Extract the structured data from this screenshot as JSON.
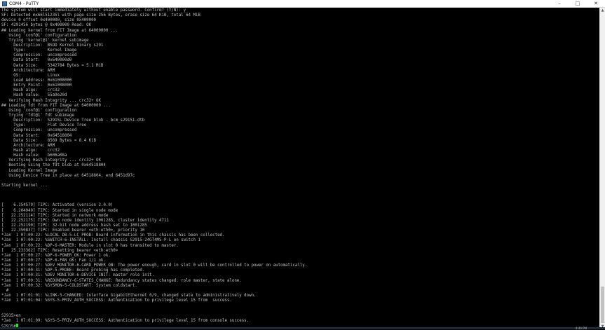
{
  "window": {
    "title": "COM4 - PuTTY",
    "controls": [
      "–",
      "□",
      "✕"
    ]
  },
  "terminal": {
    "lines": [
      "The system will start immediately without enable password. Confirm? (Y/N): y",
      "SF: Detected mx66l51235l with page size 256 Bytes, erase size 64 KiB, total 64 MiB",
      "device 0 offset 0x400000, size 0x400000",
      "SF: 4291456 bytes @ 0x400000 Read: OK",
      "## Loading kernel from FIT Image at 64000000 ...",
      "   Using 'conf@1' configuration",
      "   Trying 'kernel@1' kernel subimage",
      "     Description:  BSOD Kernel binary s291",
      "     Type:         Kernel Image",
      "     Compression:  uncompressed",
      "     Data Start:   0x640000d0",
      "     Data Size:    5342784 Bytes = 5.1 MiB",
      "     Architecture: ARM",
      "     OS:           Linux",
      "     Load Address: 0x61008000",
      "     Entry Point:  0x61008000",
      "     Hash algo:    crc32",
      "     Hash value:   55a9e20d",
      "   Verifying Hash Integrity ... crc32+ OK",
      "## Loading fdt from FIT Image at 64000000 ...",
      "   Using 'conf@1' configuration",
      "   Trying 'fdt@1' fdt subimage",
      "     Description:  S2915L Device Tree blob - bcm_s29151.dtb",
      "     Type:         Flat Device Tree",
      "     Compression:  uncompressed",
      "     Data Start:   0x64518804",
      "     Data Size:    8569 Bytes = 8.4 KiB",
      "     Architecture: ARM",
      "     Hash algo:    crc32",
      "     Hash value:   b606a08a",
      "   Verifying Hash Integrity ... crc32+ OK",
      "   Booting using the fdt blob at 0x64518804",
      "   Loading Kernel Image",
      "   Using Device Tree in place at 64518804, end 6451d97c",
      "",
      "Starting kernel ...",
      "",
      "",
      "",
      "[    6.154579] TIPC: Activated (version 2.0.0)",
      "[    6.204949] TIPC: Started in single node mode",
      "[   22.252114] TIPC: Started in network mode",
      "[   22.252175] TIPC: Own node identity 1001285, cluster identity 4711",
      "[   22.252190] TIPC: 32-bit node address hash set to 1001285",
      "[   22.350837] TIPC: Enabled bearer <eth:eth0>, priority 10",
      "*Jan  1 07:00:22: %LOCAL_DB-5-LC_PROB: Board information in this chassis has been collected.",
      "*Jan  1 07:00:22: %SWITCH-6-INSTALL: Install chassis S2915-24GT4MS-P-L on switch 1",
      "*Jan  1 07:00:22: %DP-6-MASTER: Module in slot 0 has transited to master.",
      "[   25.233362] TIPC: Resetting bearer <eth:eth0>",
      "*Jan  1 07:00:27: %DP-6-POWER_OK: Power 1 ok.",
      "*Jan  1 07:00:27: %DP-6-FAN_OK: Fan 1/1 ok.",
      "*Jan  1 07:00:27: %DEV_MONITOR-6-CARD_POWER_ON: The power enough, card in slot 0 will be controlled to power on automatically.",
      "*Jan  1 07:00:31: %DP-5-PROBE: Board probing has completed.",
      "*Jan  1 07:00:31: %DEV_MONITOR-6-DEVICE_INIT: master role init.",
      "*Jan  1 07:00:31: %REDUNDANCY-6-STATES_CHANGE: Redundancy states changed: role master, state alone.",
      "*Jan  1 07:00:32: %SYSMON-5-COLDSTART: System coldstart.",
      "  #",
      "*Jan  1 07:01:01: %LINK-5-CHANGED: Interface GigabitEthernet 0/9, changed state to administratively down.",
      "*Jan  1 07:01:04: %SYS-5-PRIV_AUTH_SUCCESS: Authentication to privilege level 15 from  success.",
      "",
      "",
      "S2915>en",
      "*Jan  1 07:01:09: %SYS-5-PRIV_AUTH_SUCCESS: Authentication to privilege level 15 from console success."
    ],
    "prompt": "S2915#",
    "cursor_color": "#00ff00",
    "text_color": "#c0c0c0",
    "background_color": "#000000"
  },
  "taskbar": {
    "clock": "4:44 PM"
  }
}
